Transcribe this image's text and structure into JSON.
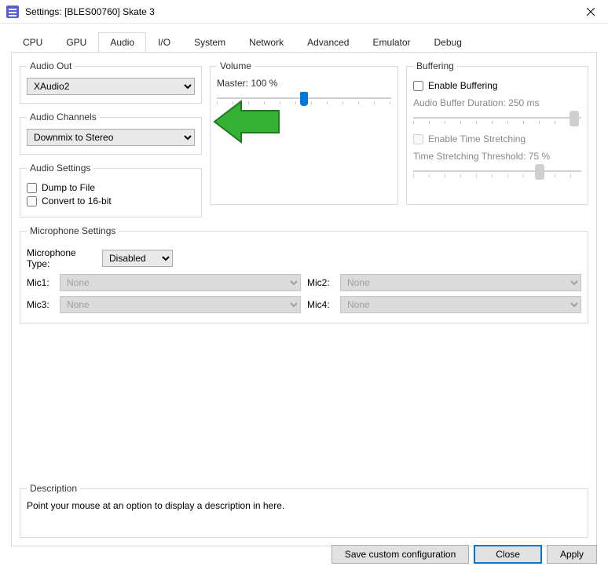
{
  "window": {
    "title": "Settings: [BLES00760] Skate 3"
  },
  "tabs": [
    "CPU",
    "GPU",
    "Audio",
    "I/O",
    "System",
    "Network",
    "Advanced",
    "Emulator",
    "Debug"
  ],
  "active_tab": "Audio",
  "audio_out": {
    "legend": "Audio Out",
    "value": "XAudio2",
    "options": [
      "XAudio2"
    ]
  },
  "audio_channels": {
    "legend": "Audio Channels",
    "value": "Downmix to Stereo",
    "options": [
      "Downmix to Stereo"
    ]
  },
  "audio_settings": {
    "legend": "Audio Settings",
    "dump": {
      "label": "Dump to File",
      "checked": false
    },
    "convert": {
      "label": "Convert to 16-bit",
      "checked": false
    }
  },
  "volume": {
    "legend": "Volume",
    "master_label": "Master: 100 %",
    "master_pct": 50
  },
  "buffering": {
    "legend": "Buffering",
    "enable": {
      "label": "Enable Buffering",
      "checked": false
    },
    "duration_label": "Audio Buffer Duration: 250 ms",
    "duration_pct": 96,
    "stretch": {
      "label": "Enable Time Stretching",
      "checked": false
    },
    "threshold_label": "Time Stretching Threshold: 75 %",
    "threshold_pct": 75
  },
  "mic": {
    "legend": "Microphone Settings",
    "type_label": "Microphone Type:",
    "type_value": "Disabled",
    "type_options": [
      "Disabled"
    ],
    "mics": [
      {
        "label": "Mic1:",
        "value": "None"
      },
      {
        "label": "Mic2:",
        "value": "None"
      },
      {
        "label": "Mic3:",
        "value": "None"
      },
      {
        "label": "Mic4:",
        "value": "None"
      }
    ]
  },
  "description": {
    "legend": "Description",
    "text": "Point your mouse at an option to display a description in here."
  },
  "buttons": {
    "save": "Save custom configuration",
    "close": "Close",
    "apply": "Apply"
  },
  "colors": {
    "accent": "#0078d7",
    "annotation": "#34b233"
  }
}
